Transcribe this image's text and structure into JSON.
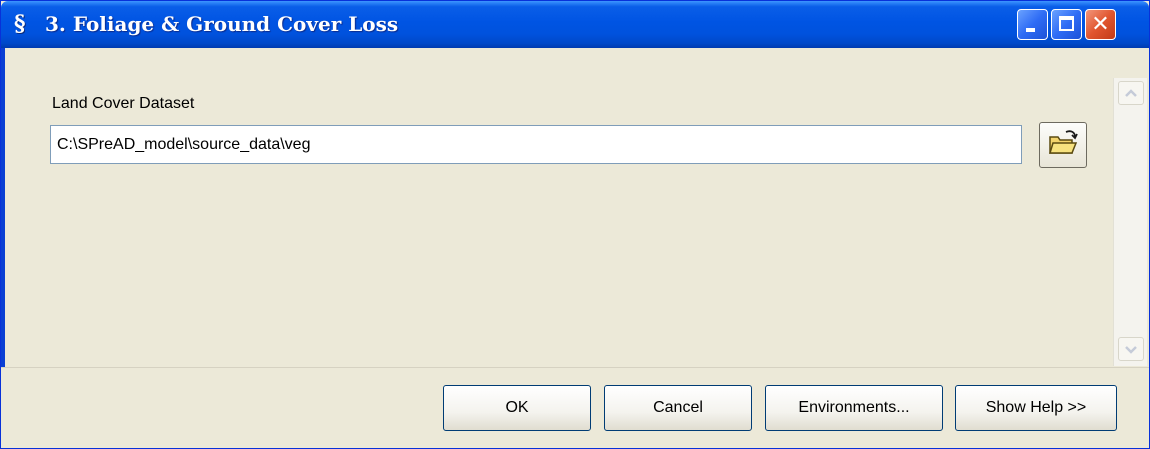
{
  "window": {
    "title": "3. Foliage & Ground Cover Loss",
    "app_icon_glyph": "§",
    "close_glyph": "✕"
  },
  "form": {
    "land_cover_label": "Land Cover Dataset",
    "land_cover_value": "C:\\SPreAD_model\\source_data\\veg"
  },
  "icons": {
    "browse": "open-folder-icon",
    "scroll_up": "scroll-up-arrow-icon",
    "scroll_down": "scroll-down-arrow-icon",
    "minimize": "minimize-icon",
    "maximize": "maximize-icon",
    "close": "close-icon"
  },
  "buttons": {
    "ok": "OK",
    "cancel": "Cancel",
    "environments": "Environments...",
    "show_help": "Show Help >>"
  },
  "colors": {
    "titlebar": "#0054e3",
    "dialog_background": "#ece9d8",
    "close_button": "#e1562f"
  }
}
